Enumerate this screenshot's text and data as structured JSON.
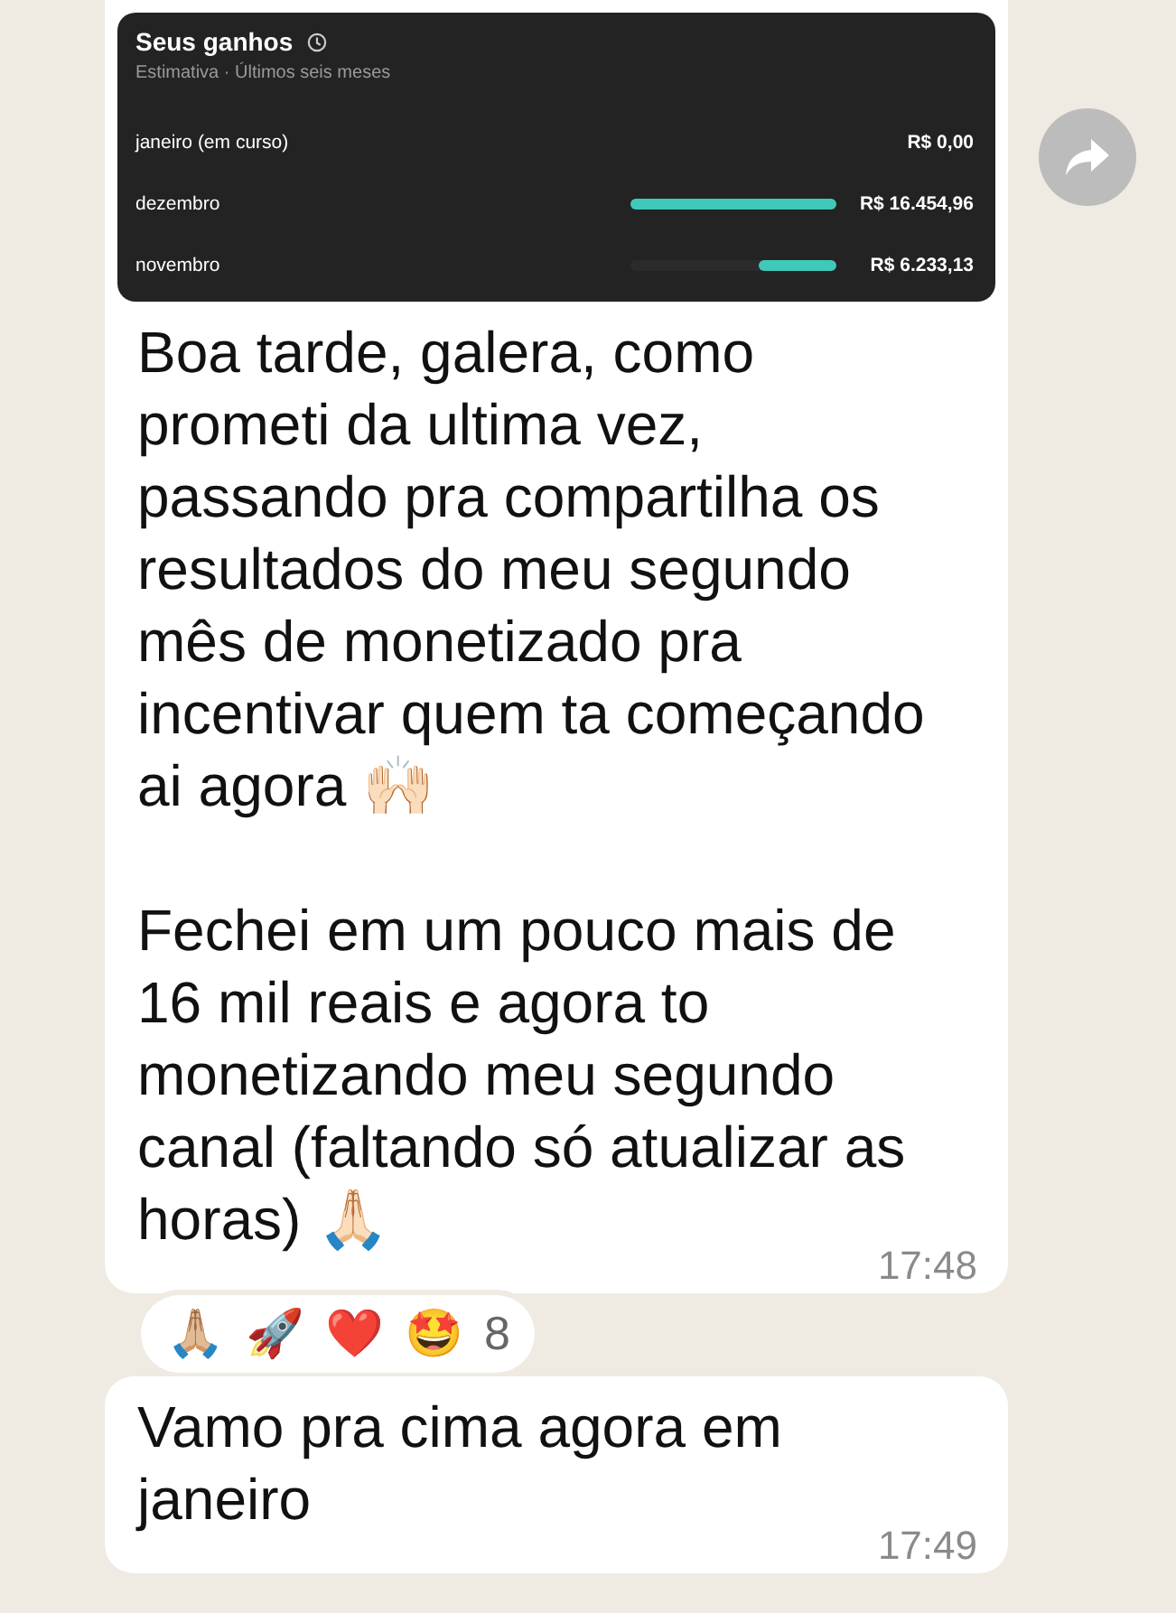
{
  "messages": [
    {
      "kind": "image_text",
      "embedded": {
        "title": "Seus ganhos",
        "subtitle": "Estimativa · Últimos seis meses",
        "rows": [
          {
            "month": "janeiro (em curso)",
            "amount": "R$ 0,00"
          },
          {
            "month": "dezembro",
            "level": 1,
            "amount": "R$ 16.454,96"
          },
          {
            "month": "novembro",
            "level": 0.38,
            "amount": "R$ 6.233,13"
          }
        ]
      },
      "paragraphs": [
        "Boa tarde, galera, como prometi da ultima vez, passando pra compartilha os resultados do meu segundo mês de monetizado pra incentivar quem ta começando ai agora 🙌🏻",
        "Fechei em um pouco mais de 16 mil reais e agora to monetizando meu segundo canal (faltando só atualizar as horas) 🙏🏻"
      ],
      "time": "17:48",
      "reactions": [
        "🙏🏼",
        "🚀",
        "❤️",
        "🤩"
      ],
      "reaction_count": "8"
    },
    {
      "kind": "text",
      "paragraphs": [
        "Vamo pra cima agora em janeiro"
      ],
      "time": "17:49"
    }
  ]
}
